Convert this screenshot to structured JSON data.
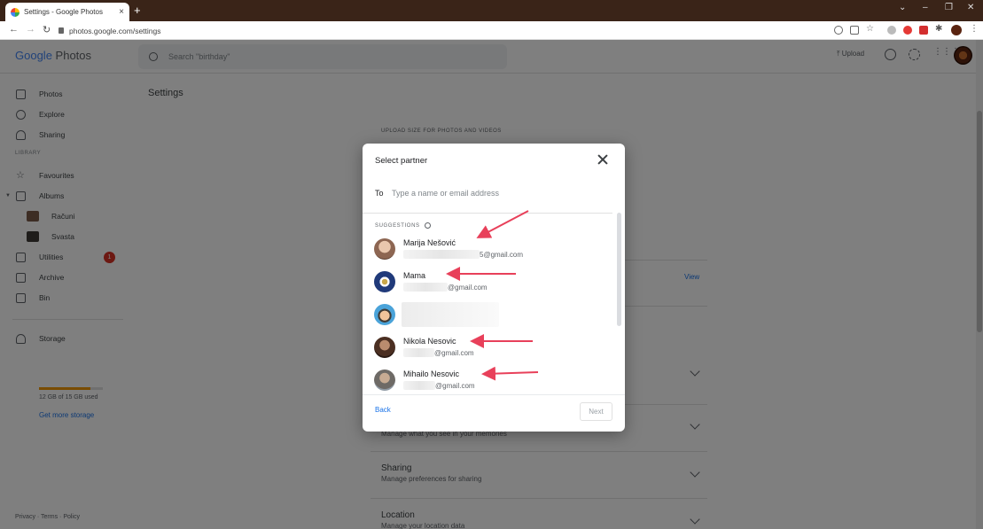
{
  "browser": {
    "tab_title": "Settings - Google Photos",
    "tab_close": "×",
    "new_tab": "+",
    "url": "photos.google.com/settings",
    "window_controls": [
      "⌄",
      "–",
      "❐",
      "✕"
    ]
  },
  "app": {
    "logo_google": "Google",
    "logo_photos": "Photos",
    "search_placeholder": "Search \"birthday\"",
    "upload_label": "Upload",
    "upload_icon": "upload-icon"
  },
  "sidebar": {
    "items": [
      {
        "label": "Photos",
        "icon": "photo-icon"
      },
      {
        "label": "Explore",
        "icon": "search-icon"
      },
      {
        "label": "Sharing",
        "icon": "people-icon"
      }
    ],
    "library_label": "LIBRARY",
    "library_items": [
      {
        "label": "Favourites",
        "icon": "star-icon"
      },
      {
        "label": "Albums",
        "icon": "album-icon"
      }
    ],
    "albums": [
      {
        "label": "Računi"
      },
      {
        "label": "Svasta"
      }
    ],
    "more_items": [
      {
        "label": "Utilities",
        "icon": "utilities-icon",
        "badge": "1"
      },
      {
        "label": "Archive",
        "icon": "archive-icon"
      },
      {
        "label": "Bin",
        "icon": "trash-icon"
      }
    ],
    "storage_label": "Storage",
    "storage_usage": "12 GB of 15 GB used",
    "storage_fraction": 0.8,
    "get_more_storage": "Get more storage",
    "footer": "Privacy · Terms · Policy"
  },
  "main": {
    "title": "Settings",
    "upload_size_label": "UPLOAD SIZE FOR PHOTOS AND VIDEOS",
    "view_link": "View",
    "sharing_title": "Sharing",
    "sharing_sub": "Manage preferences for sharing",
    "location_title": "Location",
    "location_sub": "Manage your location data",
    "memories_sub": "Manage what you see in your memories"
  },
  "dialog": {
    "title": "Select partner",
    "to_label": "To",
    "to_placeholder": "Type a name or email address",
    "suggestions_label": "SUGGESTIONS",
    "people": [
      {
        "name": "Marija Nešović",
        "email_suffix": "5@gmail.com"
      },
      {
        "name": "Mama",
        "email_suffix": "@gmail.com"
      },
      {
        "name": "",
        "email_suffix": ""
      },
      {
        "name": "Nikola Nesovic",
        "email_suffix": "@gmail.com"
      },
      {
        "name": "Mihailo Nesovic",
        "email_suffix": "@gmail.com"
      }
    ],
    "back_label": "Back",
    "next_label": "Next"
  },
  "colors": {
    "accent": "#1a73e8",
    "badge": "#d93025",
    "arrow": "#e8405a"
  }
}
